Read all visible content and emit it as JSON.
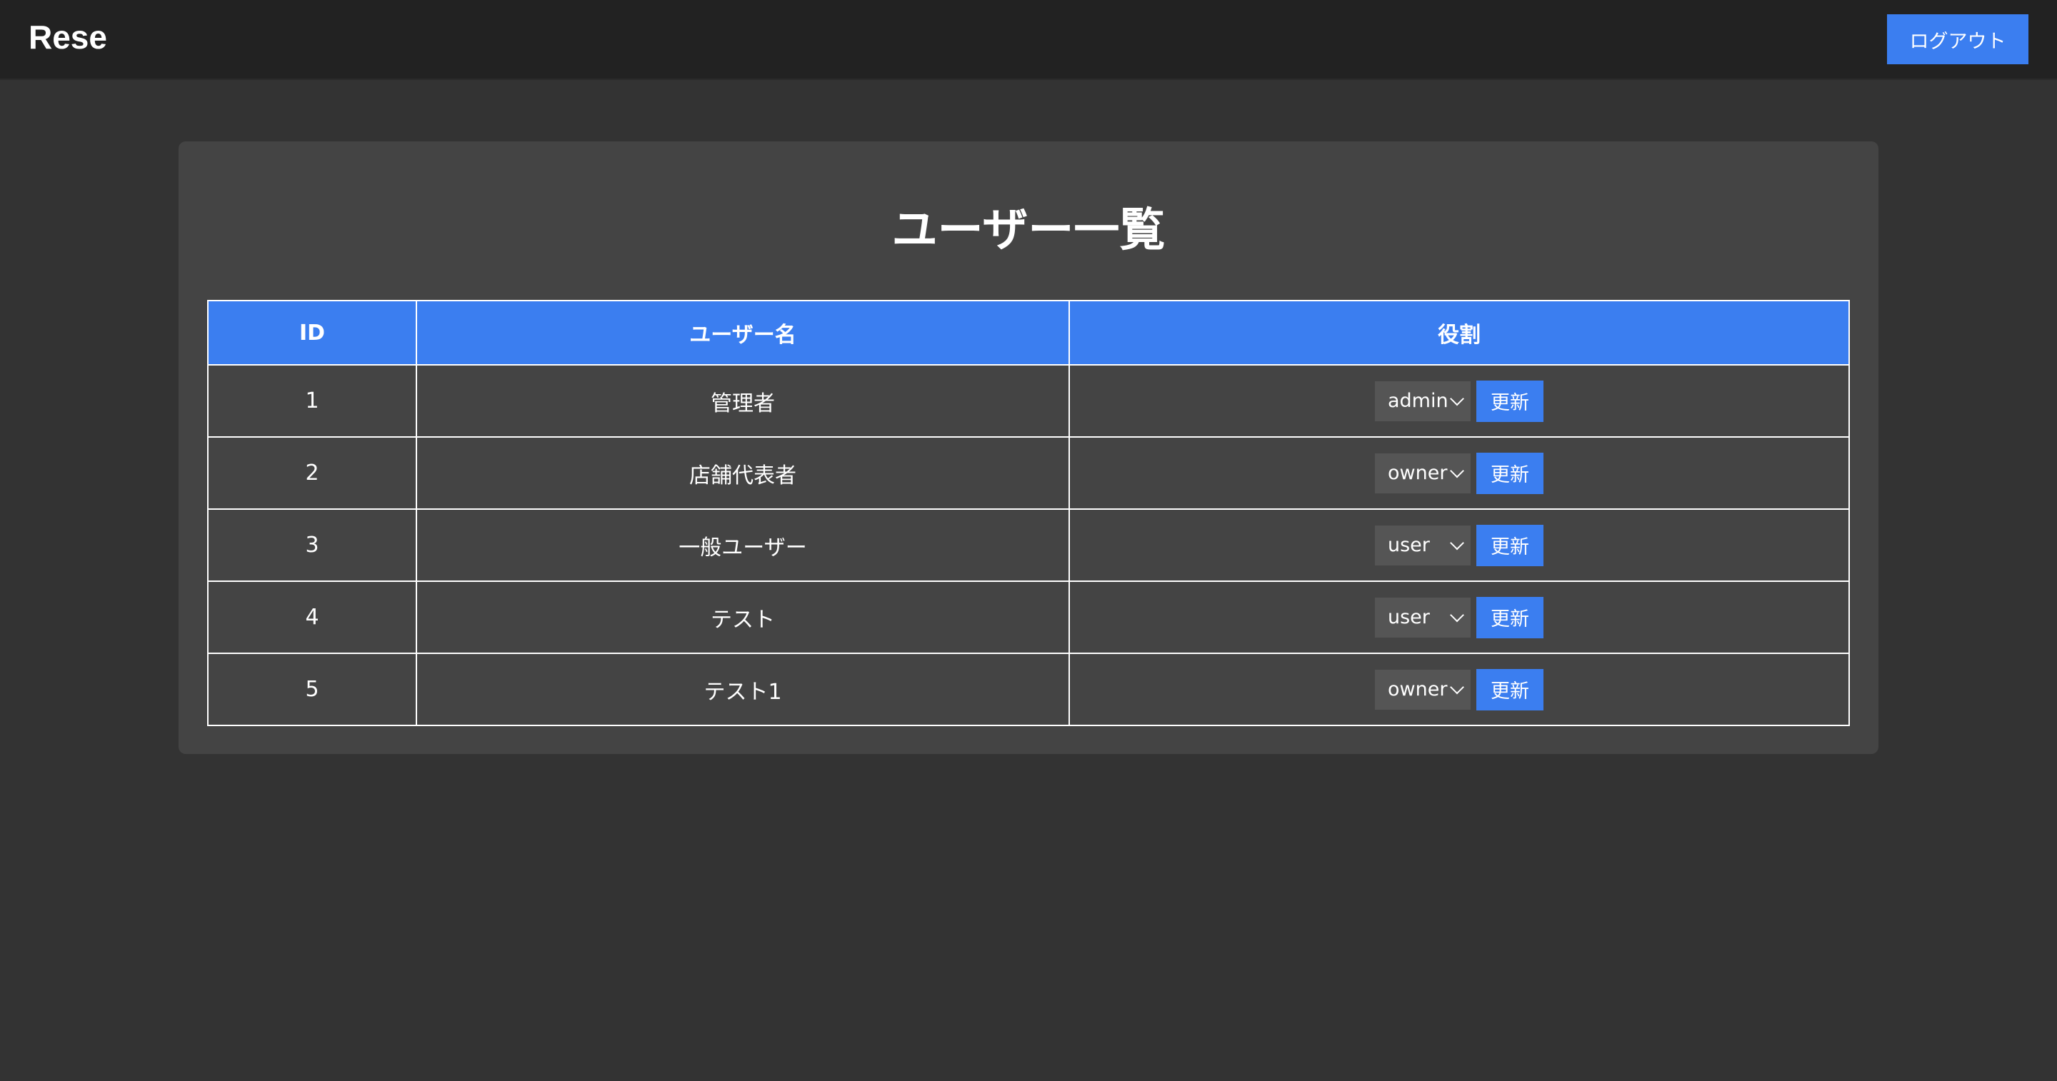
{
  "header": {
    "logo": "Rese",
    "logout_label": "ログアウト"
  },
  "main": {
    "title": "ユーザー一覧",
    "columns": [
      "ID",
      "ユーザー名",
      "役割"
    ],
    "update_label": "更新",
    "rows": [
      {
        "id": "1",
        "name": "管理者",
        "role": "admin"
      },
      {
        "id": "2",
        "name": "店舗代表者",
        "role": "owner"
      },
      {
        "id": "3",
        "name": "一般ユーザー",
        "role": "user"
      },
      {
        "id": "4",
        "name": "テスト",
        "role": "user"
      },
      {
        "id": "5",
        "name": "テスト1",
        "role": "owner"
      }
    ]
  },
  "colors": {
    "accent": "#3b7ef0",
    "header_bg": "#222222",
    "page_bg": "#333333",
    "card_bg": "#444444",
    "select_bg": "#555555"
  },
  "icons": {
    "select_arrow": "chevron-down-icon"
  }
}
